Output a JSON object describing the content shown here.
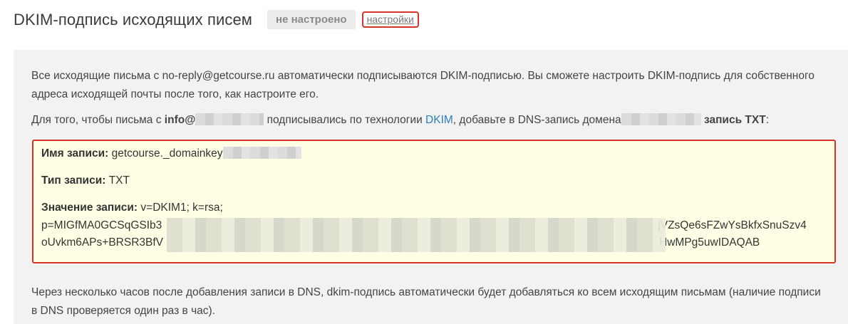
{
  "header": {
    "title": "DKIM-подпись исходящих писем",
    "status": "не настроено",
    "settings_link": "настройки"
  },
  "intro": {
    "text": "Все исходящие письма с no-reply@getcourse.ru автоматически подписываются DKIM-подписью. Вы сможете настроить DKIM-подпись для собственного адреса исходящей почты после того, как настроите его."
  },
  "instruction": {
    "part1": "Для того, чтобы письма с ",
    "email_prefix": "info@",
    "part2": " подписывались по технологии ",
    "dkim_link": "DKIM",
    "part3": ", добавьте в DNS-запись домена",
    "record_type": "запись TXT",
    "colon": ":"
  },
  "record": {
    "name_label": "Имя записи:",
    "name_value": "getcourse._domainkey",
    "type_label": "Тип записи:",
    "type_value": "TXT",
    "value_label": "Значение записи:",
    "value_line1": "v=DKIM1; k=rsa;",
    "value_line2_start": "p=MIGfMA0GCSqGSIb3",
    "value_line2_end": "jVZsQe6sFZwYsBkfxSnuSzv4",
    "value_line3_start": "oUvkm6APs+BRSR3BfV",
    "value_line3_end": "HwMPg5uwIDAQAB"
  },
  "footer_note": {
    "text": "Через несколько часов после добавления записи в DNS, dkim-подпись автоматически будет добавляться ко всем исходящим письмам (наличие подписи в DNS проверяется один раз в час)."
  },
  "colors": {
    "highlight_border": "#d6332b",
    "record_bg": "#ffffe6",
    "panel_bg": "#f2f2f2",
    "link": "#2d7fb8"
  }
}
